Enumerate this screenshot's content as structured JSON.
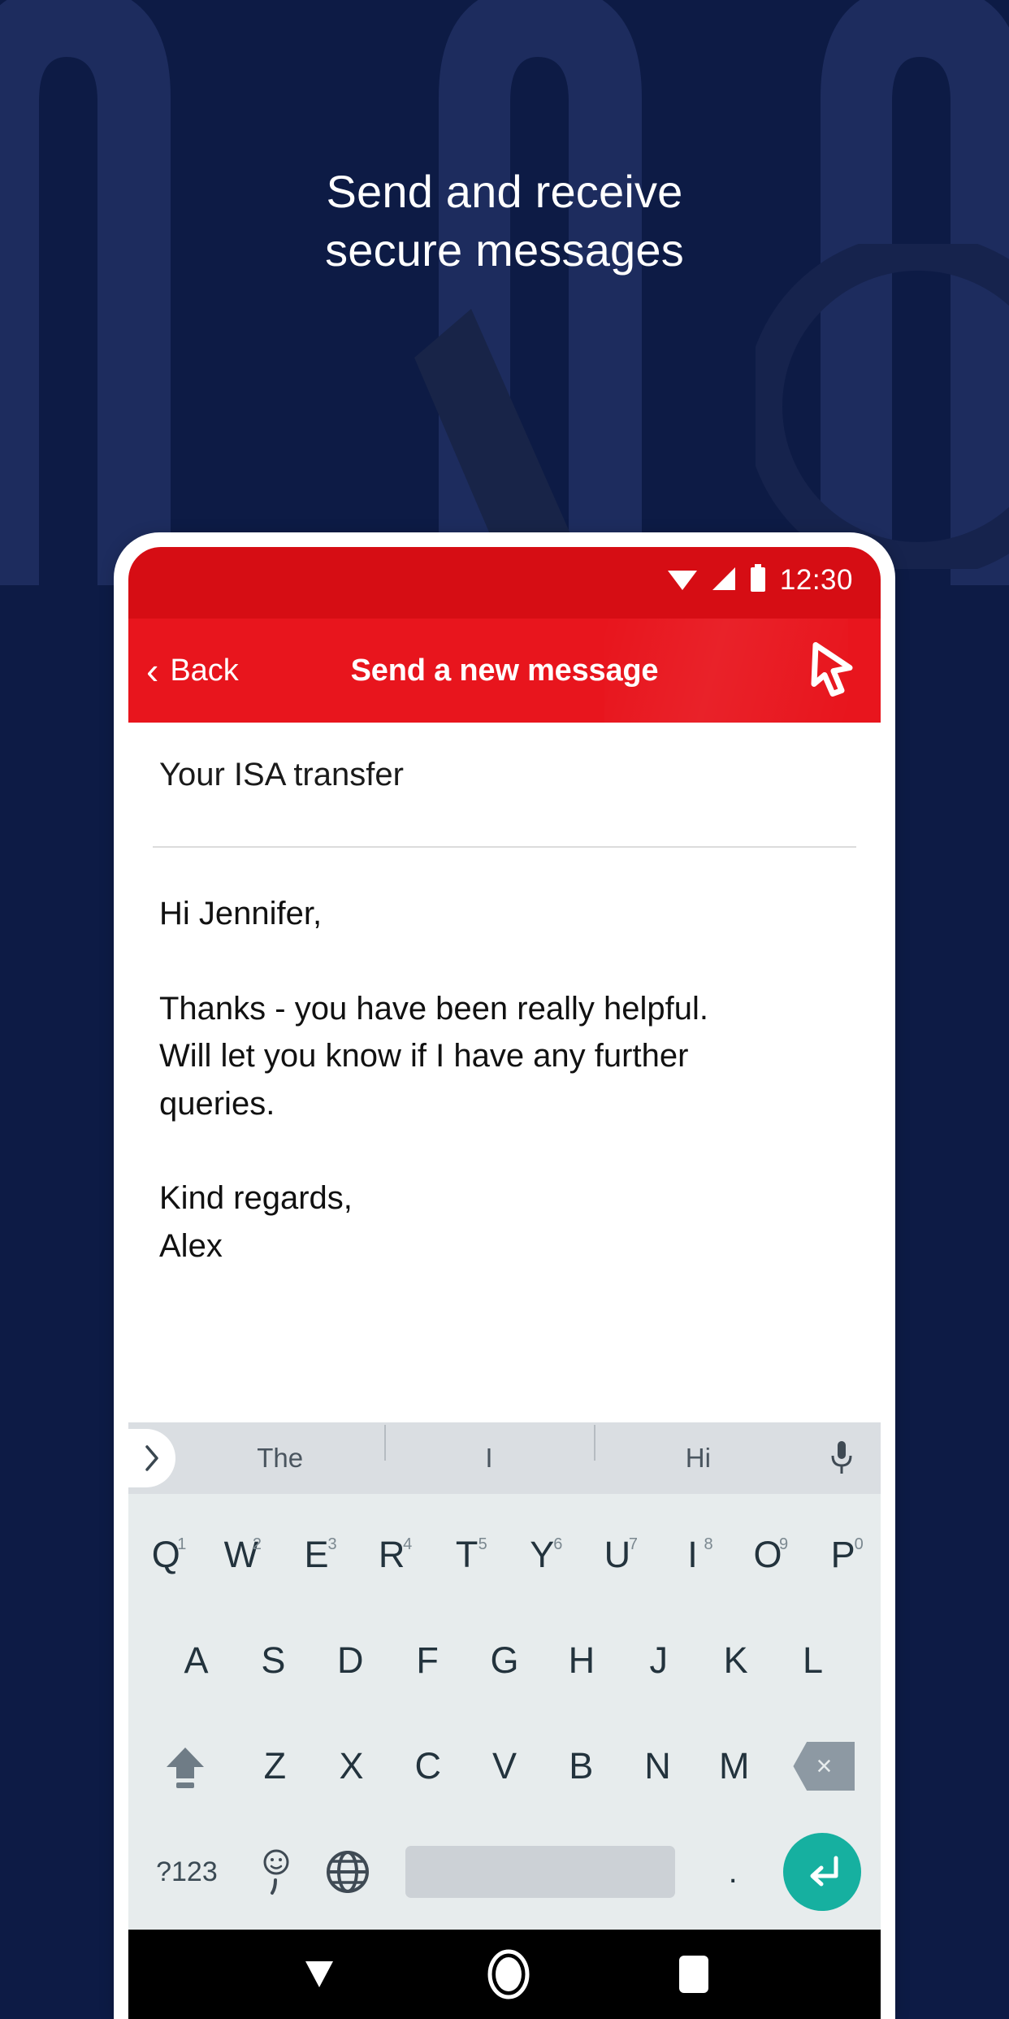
{
  "theme": {
    "background_navy": "#0d1b45",
    "watermark_navy": "#1d2c5e",
    "brand_red": "#e8151d",
    "status_red": "#d60d14",
    "enter_teal": "#16b0a0",
    "keyboard_bg": "#e7eced",
    "suggestion_bg": "#dadee2"
  },
  "headline": {
    "line1": "Send and receive",
    "line2": "secure messages"
  },
  "phone": {
    "status_bar": {
      "time": "12:30",
      "icons": [
        "wifi-icon",
        "signal-icon",
        "battery-icon"
      ]
    },
    "app_header": {
      "back_label": "Back",
      "back_chevron": "‹",
      "title": "Send a new message",
      "cursor_icon": "cursor-pointer-icon"
    },
    "compose": {
      "subject": "Your ISA transfer",
      "body": "Hi Jennifer,\n\nThanks - you have been really helpful.\nWill let you know if I have any further\nqueries.\n\nKind regards,\nAlex"
    },
    "keyboard": {
      "suggestions": {
        "expand_icon": "chevron-right-icon",
        "words": [
          "The",
          "I",
          "Hi"
        ],
        "mic_icon": "microphone-icon"
      },
      "row1": [
        {
          "letter": "Q",
          "num": "1"
        },
        {
          "letter": "W",
          "num": "2"
        },
        {
          "letter": "E",
          "num": "3"
        },
        {
          "letter": "R",
          "num": "4"
        },
        {
          "letter": "T",
          "num": "5"
        },
        {
          "letter": "Y",
          "num": "6"
        },
        {
          "letter": "U",
          "num": "7"
        },
        {
          "letter": "I",
          "num": "8"
        },
        {
          "letter": "O",
          "num": "9"
        },
        {
          "letter": "P",
          "num": "0"
        }
      ],
      "row2": [
        "A",
        "S",
        "D",
        "F",
        "G",
        "H",
        "J",
        "K",
        "L"
      ],
      "row3": [
        "Z",
        "X",
        "C",
        "V",
        "B",
        "N",
        "M"
      ],
      "shift_icon": "shift-arrow-icon",
      "backspace_icon": "backspace-icon",
      "backspace_glyph": "×",
      "row4": {
        "numsym_label": "?123",
        "emoji_label": ",",
        "emoji_icon": "emoji-smiley-icon",
        "globe_icon": "globe-icon",
        "space_label": "",
        "period_label": ".",
        "enter_icon": "enter-return-icon"
      }
    },
    "nav_bar": {
      "back_icon": "nav-back-triangle-icon",
      "home_icon": "nav-home-circle-icon",
      "recents_icon": "nav-recents-square-icon"
    }
  }
}
